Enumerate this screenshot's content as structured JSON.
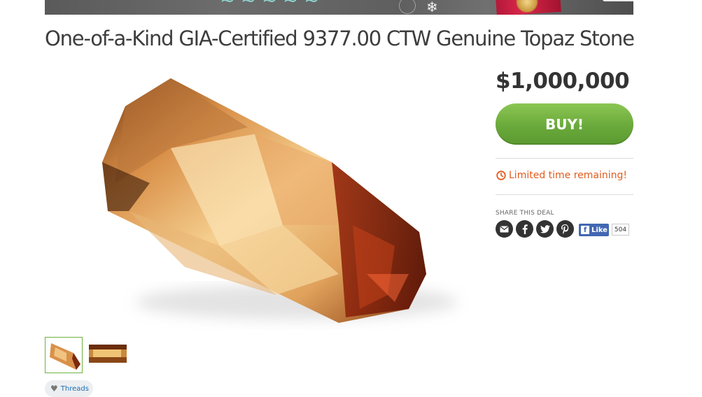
{
  "banner": {},
  "product": {
    "title": "One-of-a-Kind GIA-Certified 9377.00 CTW Genuine Topaz Stone",
    "price": "$1,000,000"
  },
  "actions": {
    "buy_label": "BUY!",
    "limited_text": "Limited time remaining!"
  },
  "share": {
    "label": "SHARE THIS DEAL",
    "icons": [
      "email-icon",
      "facebook-icon",
      "twitter-icon",
      "pinterest-icon"
    ],
    "fb_like_label": "Like",
    "fb_like_count": "504"
  },
  "tags": {
    "threads_label": "Threads"
  },
  "colors": {
    "buy_green": "#6aa93b",
    "urgency_orange": "#e25b1c",
    "facebook_blue": "#4267b2",
    "link_blue": "#1e6db3"
  }
}
